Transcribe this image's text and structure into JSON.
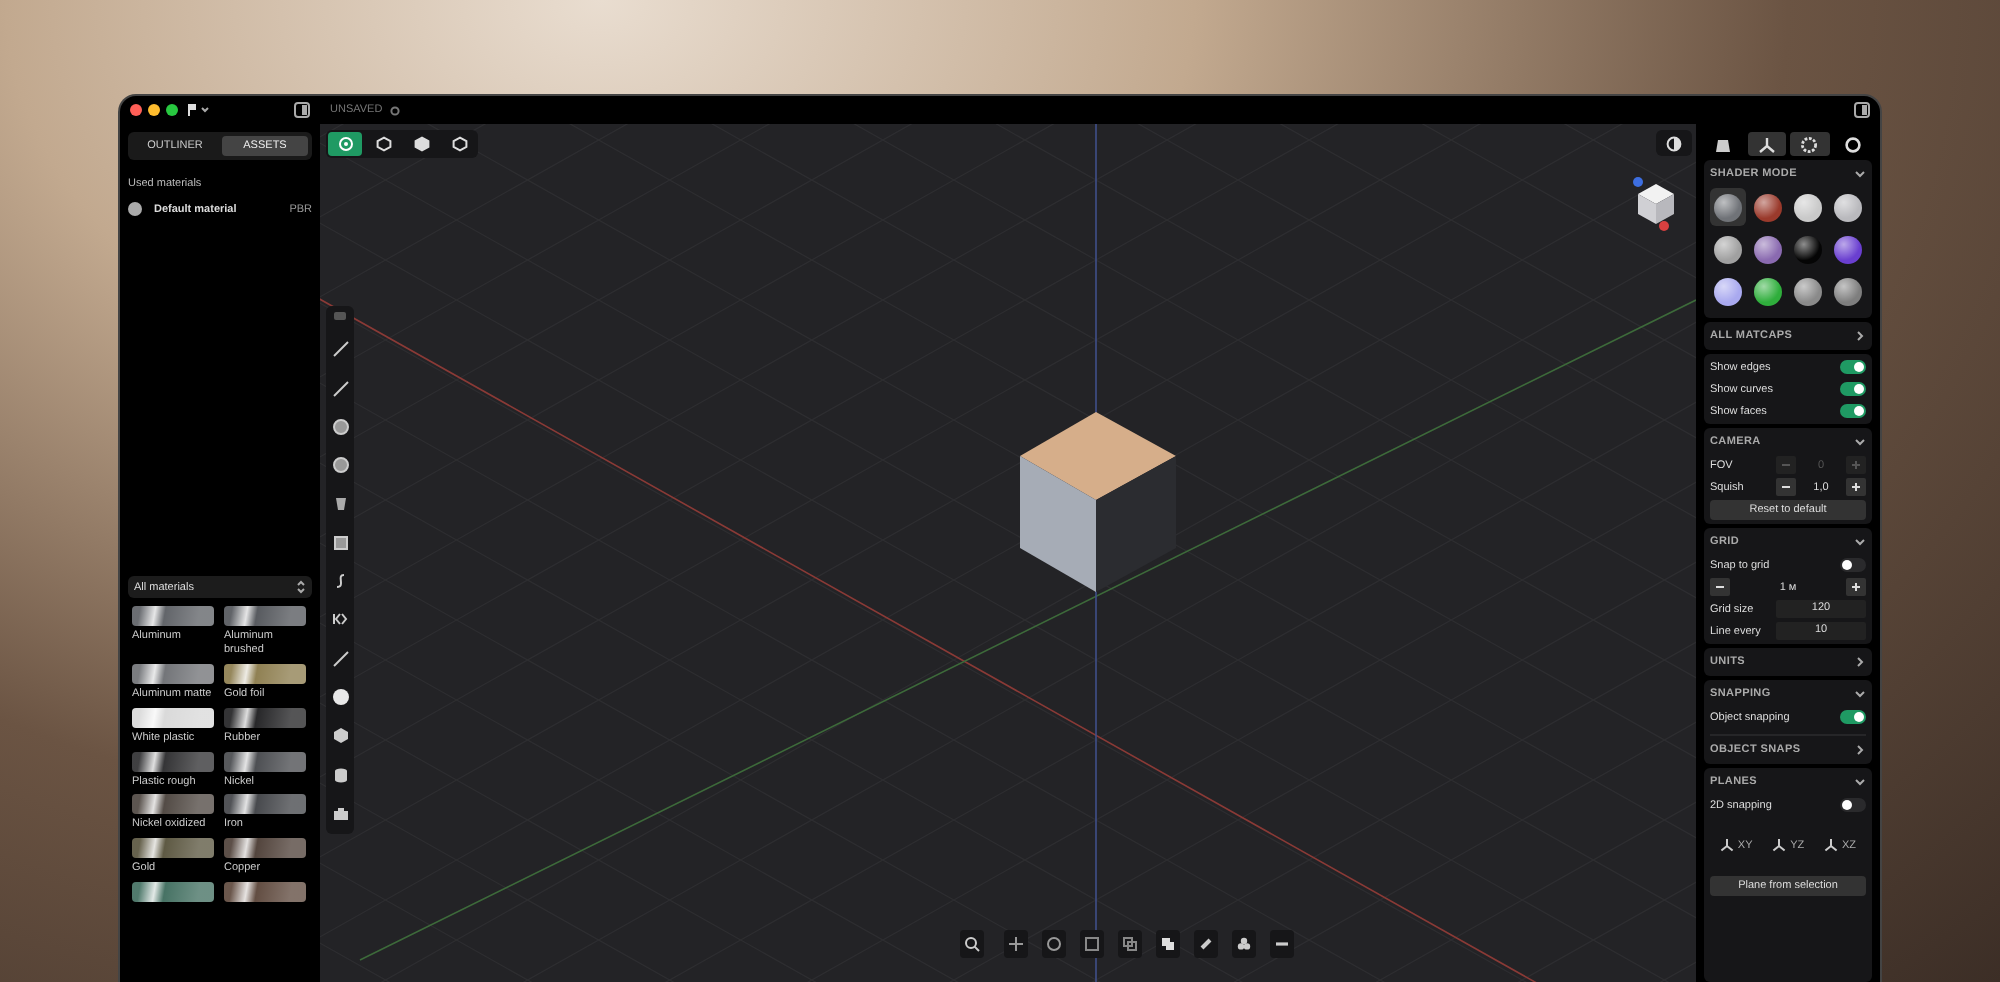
{
  "window": {
    "title": "UNSAVED"
  },
  "left_tabs": [
    {
      "label": "OUTLINER",
      "selected": false
    },
    {
      "label": "ASSETS",
      "selected": true
    }
  ],
  "used_materials": {
    "heading": "Used materials",
    "items": [
      {
        "name": "Default material",
        "type": "PBR"
      }
    ]
  },
  "materials": {
    "filter": "All materials",
    "items": [
      {
        "name": "Aluminum",
        "color": "#5a5d62"
      },
      {
        "name": "Aluminum brushed",
        "color": "#4f5257"
      },
      {
        "name": "Aluminum matte",
        "color": "#6c6e72"
      },
      {
        "name": "Gold foil",
        "color": "#8a7a4a"
      },
      {
        "name": "White plastic",
        "color": "#d8d8d8"
      },
      {
        "name": "Rubber",
        "color": "#1c1c1e"
      },
      {
        "name": "Plastic rough",
        "color": "#2a2a2c"
      },
      {
        "name": "Nickel",
        "color": "#44464a"
      },
      {
        "name": "Nickel oxidized",
        "color": "#4a423c"
      },
      {
        "name": "Iron",
        "color": "#3e4044"
      },
      {
        "name": "Gold",
        "color": "#56513a"
      },
      {
        "name": "Copper",
        "color": "#4a3b33"
      },
      {
        "color": "#3d6b5c"
      },
      {
        "color": "#5a4438"
      }
    ]
  },
  "view_modes": [
    {
      "selected": true
    },
    {
      "selected": false
    },
    {
      "selected": false
    },
    {
      "selected": false
    }
  ],
  "right_tabs": [
    {
      "selected": false
    },
    {
      "selected": true
    },
    {
      "selected": true
    },
    {
      "selected": false
    }
  ],
  "shader_mode": {
    "heading": "SHADER MODE",
    "expanded": true,
    "matcaps": [
      {
        "color": "#707378",
        "selected": true
      },
      {
        "color": "#9a3a2c",
        "selected": false
      },
      {
        "color": "#c9c9c9",
        "selected": false
      },
      {
        "color": "#b9b9bd",
        "selected": false
      },
      {
        "color": "#a0a0a0",
        "selected": false
      },
      {
        "color": "#8a6ab0",
        "selected": false
      },
      {
        "color": "#050505",
        "selected": false
      },
      {
        "color": "#6a3fd0",
        "selected": false
      },
      {
        "color": "#a9a9ef",
        "selected": false
      },
      {
        "color": "#2fae3c",
        "selected": false
      },
      {
        "color": "#8a8a8a",
        "selected": false
      },
      {
        "color": "#7e7e7e",
        "selected": false
      }
    ]
  },
  "all_matcaps": {
    "heading": "ALL MATCAPS",
    "expanded": false
  },
  "display_toggles": [
    {
      "label": "Show edges",
      "on": true
    },
    {
      "label": "Show curves",
      "on": true
    },
    {
      "label": "Show faces",
      "on": true
    }
  ],
  "camera": {
    "heading": "CAMERA",
    "expanded": true,
    "fov": {
      "label": "FOV",
      "value": "0",
      "disabled": true
    },
    "squish": {
      "label": "Squish",
      "value": "1,0",
      "disabled": false
    },
    "reset_button": "Reset to default"
  },
  "grid": {
    "heading": "GRID",
    "expanded": true,
    "snap": {
      "label": "Snap to grid",
      "on": false
    },
    "step": {
      "value": "1 м"
    },
    "fields": [
      {
        "label": "Grid size",
        "value": "120"
      },
      {
        "label": "Line every",
        "value": "10"
      }
    ]
  },
  "units": {
    "heading": "UNITS",
    "expanded": false
  },
  "snapping": {
    "heading": "SNAPPING",
    "expanded": true,
    "toggle": {
      "label": "Object snapping",
      "on": true
    }
  },
  "object_snaps": {
    "heading": "OBJECT SNAPS",
    "expanded": false
  },
  "planes": {
    "heading": "PLANES",
    "expanded": true,
    "toggle": {
      "label": "2D snapping",
      "on": false
    },
    "axes": [
      "XY",
      "YZ",
      "XZ"
    ],
    "button": "Plane from selection"
  }
}
